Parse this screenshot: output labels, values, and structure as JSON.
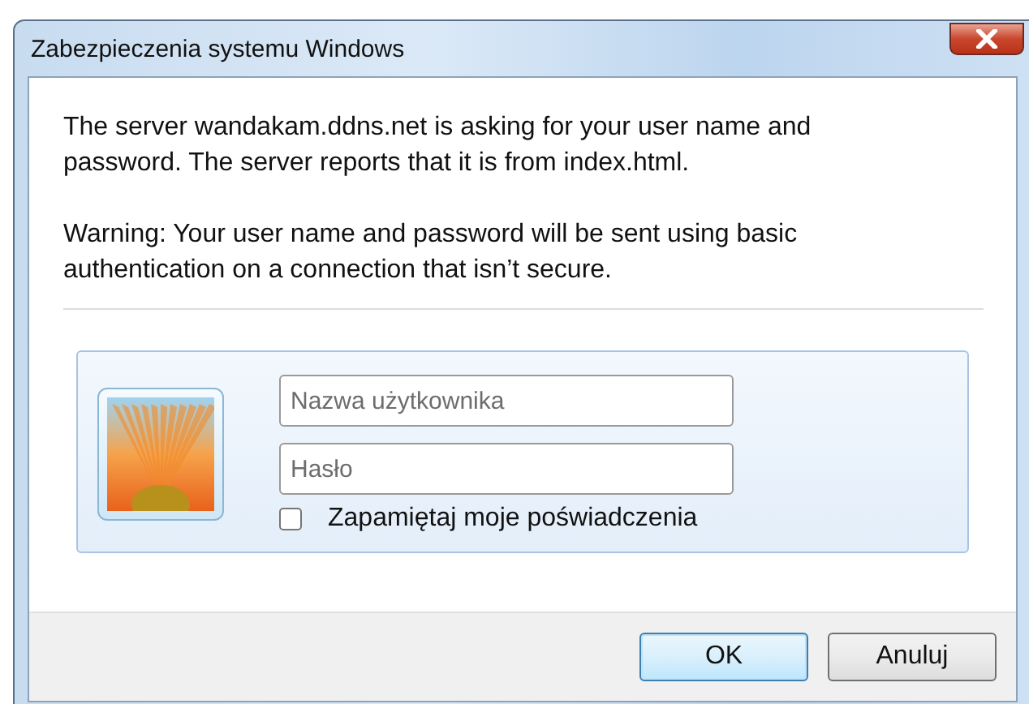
{
  "window": {
    "title": "Zabezpieczenia systemu Windows"
  },
  "message": "The server wandakam.ddns.net is asking for your user name and password. The server reports that it is from index.html.",
  "warning": "Warning: Your user name and password will be sent using basic authentication on a connection that isn’t secure.",
  "credentials": {
    "username": {
      "placeholder": "Nazwa użytkownika"
    },
    "password": {
      "placeholder": "Hasło"
    },
    "remember": {
      "label": "Zapamiętaj moje poświadczenia",
      "checked": false
    }
  },
  "buttons": [
    {
      "label": "OK",
      "default": true
    },
    {
      "label": "Anuluj",
      "default": false
    }
  ]
}
